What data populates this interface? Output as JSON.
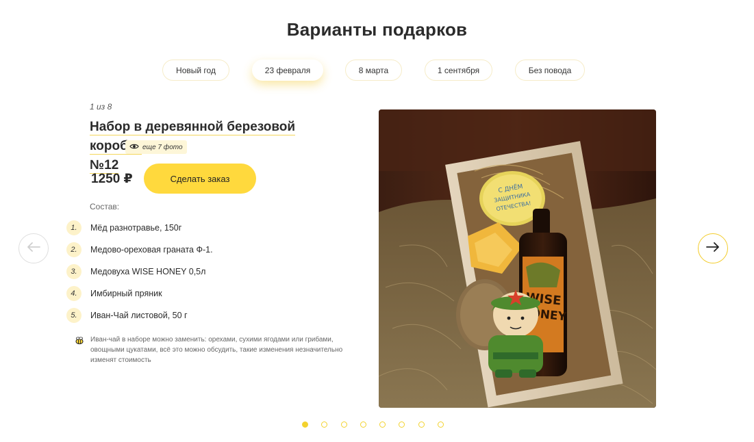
{
  "section_title": "Варианты подарков",
  "tabs": [
    {
      "label": "Новый год",
      "active": false
    },
    {
      "label": "23 февраля",
      "active": true
    },
    {
      "label": "8 марта",
      "active": false
    },
    {
      "label": "1 сентября",
      "active": false
    },
    {
      "label": "Без повода",
      "active": false
    }
  ],
  "slide": {
    "counter": "1 из 8",
    "title_line1": "Набор в деревянной березовой коробке",
    "title_line2": "№12",
    "more_photos": "еще 7 фото",
    "price": "1250 ₽",
    "order_button": "Сделать заказ",
    "composition_label": "Состав:",
    "composition": [
      {
        "num": "1.",
        "text": "Мёд разнотравье, 150г"
      },
      {
        "num": "2.",
        "text": "Медово-ореховая граната Ф-1."
      },
      {
        "num": "3.",
        "text": "Медовуха WISE HONEY 0,5л"
      },
      {
        "num": "4.",
        "text": "Имбирный пряник"
      },
      {
        "num": "5.",
        "text": "Иван-Чай листовой, 50 г"
      }
    ],
    "note": "Иван-чай в наборе можно заменить: орехами, сухими ягодами или грибами, овощными цукатами, всё это можно обсудить, такие изменения незначительно изменят стоимость",
    "photo": {
      "cookie_text": "С Днём защитника Отечества!",
      "bottle_label_1": "WISE",
      "bottle_label_2": "HONEY"
    }
  },
  "pagination": {
    "total": 8,
    "current": 1
  },
  "colors": {
    "accent": "#ffd93d",
    "accent_border": "#f3cc2a",
    "tab_border": "#f6ecc8",
    "num_bg": "#fdf2c9"
  },
  "icons": {
    "prev": "arrow-left-icon",
    "next": "arrow-right-icon",
    "eye": "eye-icon",
    "note": "bee-icon"
  }
}
